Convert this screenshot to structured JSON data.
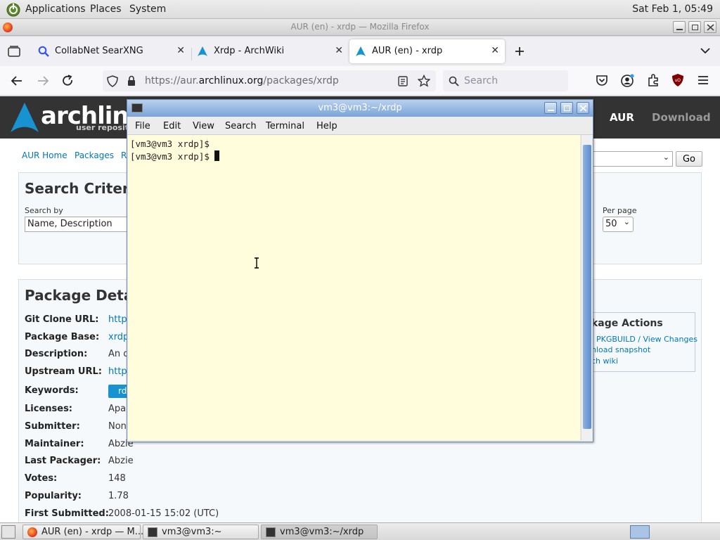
{
  "top_panel": {
    "menus": [
      "Applications",
      "Places",
      "System"
    ],
    "clock": "Sat Feb  1, 05:49"
  },
  "firefox": {
    "window_title": "AUR (en) - xrdp — Mozilla Firefox",
    "tabs": [
      {
        "label": "CollabNet SearXNG",
        "icon": "search-icon"
      },
      {
        "label": "Xrdp - ArchWiki",
        "icon": "arch-logo-icon"
      },
      {
        "label": "AUR (en) - xrdp",
        "icon": "arch-logo-icon",
        "active": true
      }
    ],
    "url_prefix": "https://aur.",
    "url_domain": "archlinux.org",
    "url_path": "/packages/xrdp",
    "search_placeholder": "Search"
  },
  "aur_page": {
    "logo_text": "archlinu",
    "logo_sub": "user reposito",
    "nav_aur": "AUR",
    "nav_download": "Download",
    "breadcrumbs": [
      "AUR Home",
      "Packages",
      "R"
    ],
    "search_criteria": {
      "heading": "Search Criteria",
      "search_by_label": "Search by",
      "search_by_value": "Name, Description",
      "per_page_label": "Per page",
      "per_page_value": "50",
      "go_button": "Go"
    },
    "package_details": {
      "heading": "Package Details",
      "rows": [
        {
          "label": "Git Clone URL:",
          "value": "https:",
          "link": true
        },
        {
          "label": "Package Base:",
          "value": "xrdp",
          "link": true
        },
        {
          "label": "Description:",
          "value": "An o",
          "link": false
        },
        {
          "label": "Upstream URL:",
          "value": "https:",
          "link": true
        },
        {
          "label": "Keywords:",
          "value": "",
          "link": false
        },
        {
          "label": "Licenses:",
          "value": "Apac",
          "link": false
        },
        {
          "label": "Submitter:",
          "value": "None",
          "link": false
        },
        {
          "label": "Maintainer:",
          "value": "Abzie",
          "link": false
        },
        {
          "label": "Last Packager:",
          "value": "Abzie",
          "link": false
        },
        {
          "label": "Votes:",
          "value": "148",
          "link": false
        },
        {
          "label": "Popularity:",
          "value": "1.78",
          "link": false
        },
        {
          "label": "First Submitted:",
          "value": "2008-01-15 15:02 (UTC)",
          "link": false
        }
      ],
      "keyword_badge": "rd"
    },
    "package_actions": {
      "heading": "kage Actions",
      "links": [
        "PKGBUILD / View Changes",
        "nload snapshot",
        "ch wiki"
      ]
    }
  },
  "terminal": {
    "title": "vm3@vm3:~/xrdp",
    "menus": [
      "File",
      "Edit",
      "View",
      "Search",
      "Terminal",
      "Help"
    ],
    "lines": [
      "[vm3@vm3 xrdp]$",
      "[vm3@vm3 xrdp]$ "
    ]
  },
  "bottom_panel": {
    "tasks": [
      {
        "label": "AUR (en) - xrdp — M...",
        "icon": "firefox-icon"
      },
      {
        "label": "vm3@vm3:~",
        "icon": "terminal-icon"
      },
      {
        "label": "vm3@vm3:~/xrdp",
        "icon": "terminal-icon",
        "active": true
      }
    ]
  }
}
